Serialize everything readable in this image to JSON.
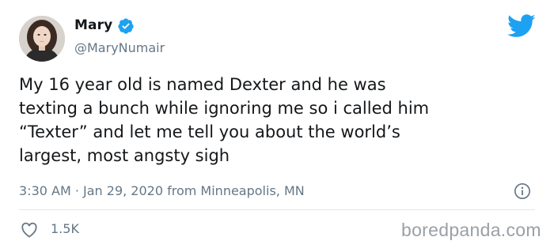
{
  "author": {
    "name": "Mary",
    "handle": "@MaryNumair",
    "verified": true
  },
  "tweet": {
    "text": "My 16 year old is named Dexter and he was\ntexting a bunch while ignoring me so i called him\n“Texter” and let me tell you about the world’s\nlargest, most angsty sigh",
    "meta": "3:30 AM · Jan 29, 2020 from Minneapolis, MN"
  },
  "engagement": {
    "likes": "1.5K"
  },
  "watermark": "boredpanda.com",
  "icons": {
    "bird": "twitter-bird-icon",
    "verified": "verified-badge-icon",
    "info": "info-icon",
    "like": "heart-icon"
  },
  "colors": {
    "twitter_blue": "#1da1f2",
    "secondary_text": "#657786",
    "primary_text": "#14171a",
    "divider": "#e1e8ed"
  }
}
